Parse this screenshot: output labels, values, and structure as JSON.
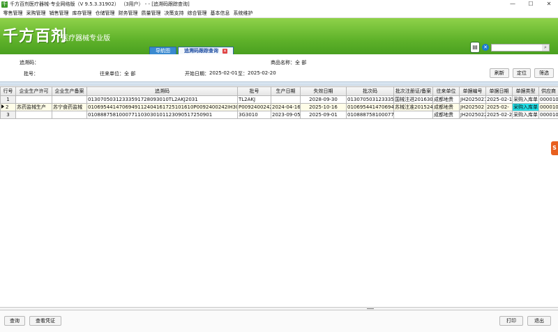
{
  "window": {
    "title": "千方百剂医疗器械-专业网络版（V 9.5.3.31902） （3用户） - - [追溯码跟踪查询]",
    "minimize": "—",
    "maximize": "☐",
    "close": "✕"
  },
  "menu": [
    "零售管理",
    "采购管理",
    "销售管理",
    "库存管理",
    "仓储管理",
    "财务管理",
    "质量管理",
    "决策支持",
    "综合管理",
    "基本信息",
    "系统维护"
  ],
  "banner": {
    "logo": "千方百剂",
    "subtitle": "医疗器械专业版",
    "tab_nav": "导航图",
    "tab_active": "追溯码跟踪查询",
    "search_placeholder": ""
  },
  "filters": {
    "trace_code_label": "追溯码：",
    "trace_code_value": "",
    "product_name_label": "商品名称：",
    "product_name_value": "全  部",
    "batch_label": "批号：",
    "batch_value": "",
    "partner_label": "往来单位：",
    "partner_value": "全  部",
    "start_date_label": "开始日期：",
    "start_date_value": "2025-02-01",
    "to_label": "至：",
    "end_date_value": "2025-02-20",
    "refresh_btn": "刷新",
    "locate_btn": "定位",
    "filter_btn": "筛选"
  },
  "grid": {
    "columns": [
      "行号",
      "企业生产许可",
      "企业生产备案",
      "追溯码",
      "批号",
      "生产日期",
      "失效日期",
      "批次码",
      "批次注册证/备案",
      "往来单位",
      "单据编号",
      "单据日期",
      "单据类型",
      "供应商"
    ],
    "rows": [
      [
        "1",
        "",
        "",
        "01307050312333591728093010TL2AKJ2031",
        "TL2AKJ",
        "",
        "2028-09-30",
        "0130705031233359",
        "1",
        "国械注进20163024",
        "成都地贵",
        "JH20250219",
        "2025-02-19",
        "采购入库单",
        "0000100"
      ],
      [
        "2",
        "苏药监械生产",
        "苏宁食药监械",
        "0106954414706949112404161725101610P0092400242IH300",
        "P0092400242",
        "2024-04-16",
        "2025-10-16",
        "0106954414706949",
        "苏械注准2015240",
        "成都地贵",
        "JH202502",
        "2025-02-",
        "采购入库单",
        "0000100"
      ],
      [
        "3",
        "",
        "",
        "0108887581000771103030101123090517250901",
        "3G3010",
        "2023-09-05",
        "2025-09-01",
        "01088875810007711",
        "",
        "成都地贵",
        "JH2025022",
        "2025-02-20",
        "采购入库单",
        "0000100"
      ]
    ]
  },
  "footer": {
    "query_btn": "查询",
    "voucher_btn": "查看凭证",
    "print_btn": "打印",
    "exit_btn": "退出"
  },
  "side_badge": "S"
}
